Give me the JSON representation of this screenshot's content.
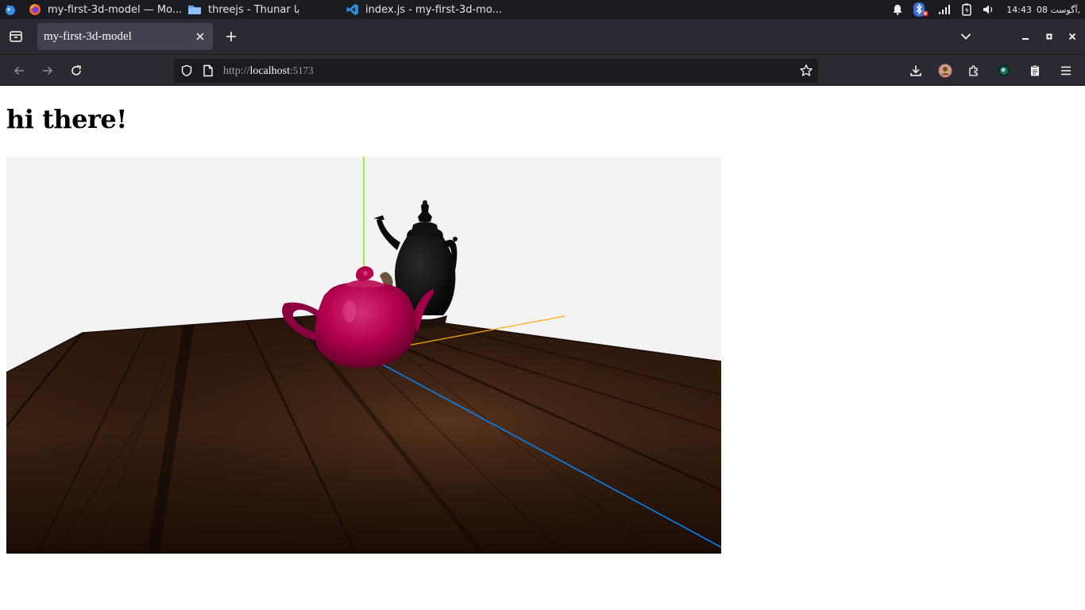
{
  "taskbar": {
    "tasks": [
      {
        "label": "my-first-3d-model — Mo...",
        "icon": "firefox-icon"
      },
      {
        "label": "threejs - Thunar با",
        "icon": "folder-icon"
      },
      {
        "label": "index.js - my-first-3d-mo...",
        "icon": "vscode-icon"
      }
    ],
    "clock": "14:43",
    "date": "08 آگوست,"
  },
  "browser": {
    "tab_title": "my-first-3d-model",
    "url_scheme": "http://",
    "url_host": "localhost",
    "url_port": ":5173"
  },
  "page": {
    "heading": "hi there!"
  },
  "colors": {
    "taskbar_bg": "#1b1b22",
    "chrome_bg": "#2b2a33",
    "tab_active": "#42414d",
    "urlbar_bg": "#1c1b22",
    "scene_background": "#f3f2f5",
    "teapot": "#b4004e",
    "table_wood": "#3a2112",
    "axis_x": "#ffaa00",
    "axis_y": "#88ee00",
    "axis_z": "#0088ff"
  }
}
